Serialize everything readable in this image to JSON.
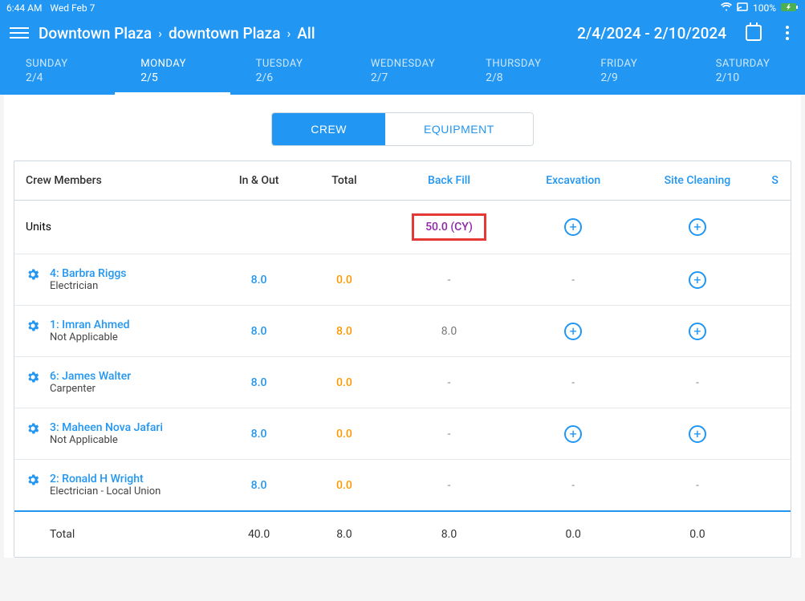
{
  "status": {
    "time": "6:44 AM",
    "date": "Wed Feb 7",
    "battery": "100%"
  },
  "breadcrumb": {
    "a": "Downtown Plaza",
    "b": "downtown Plaza",
    "c": "All"
  },
  "dateRange": "2/4/2024 - 2/10/2024",
  "days": [
    {
      "name": "SUNDAY",
      "date": "2/4",
      "active": false
    },
    {
      "name": "MONDAY",
      "date": "2/5",
      "active": true
    },
    {
      "name": "TUESDAY",
      "date": "2/6",
      "active": false
    },
    {
      "name": "WEDNESDAY",
      "date": "2/7",
      "active": false
    },
    {
      "name": "THURSDAY",
      "date": "2/8",
      "active": false
    },
    {
      "name": "FRIDAY",
      "date": "2/9",
      "active": false
    },
    {
      "name": "SATURDAY",
      "date": "2/10",
      "active": false
    }
  ],
  "toggle": {
    "crew": "CREW",
    "equipment": "EQUIPMENT"
  },
  "columns": {
    "members": "Crew Members",
    "inout": "In & Out",
    "total": "Total",
    "backfill": "Back Fill",
    "excavation": "Excavation",
    "site": "Site Cleaning",
    "s": "S"
  },
  "unitsLabel": "Units",
  "unitsBackfill": "50.0 (CY)",
  "crew": [
    {
      "name": "4: Barbra Riggs",
      "role": "Electrician",
      "inout": "8.0",
      "total": "0.0",
      "backfill": "-",
      "excavation": "-",
      "site": "plus"
    },
    {
      "name": "1: Imran Ahmed",
      "role": "Not Applicable",
      "inout": "8.0",
      "total": "8.0",
      "backfill": "8.0",
      "excavation": "plus",
      "site": "plus"
    },
    {
      "name": "6: James Walter",
      "role": "Carpenter",
      "inout": "8.0",
      "total": "0.0",
      "backfill": "-",
      "excavation": "-",
      "site": "-"
    },
    {
      "name": "3: Maheen  Nova Jafari",
      "role": "Not Applicable",
      "inout": "8.0",
      "total": "0.0",
      "backfill": "-",
      "excavation": "plus",
      "site": "plus"
    },
    {
      "name": "2: Ronald H Wright",
      "role": "Electrician - Local Union",
      "inout": "8.0",
      "total": "0.0",
      "backfill": "-",
      "excavation": "-",
      "site": "-"
    }
  ],
  "totals": {
    "label": "Total",
    "inout": "40.0",
    "total": "8.0",
    "backfill": "8.0",
    "excavation": "0.0",
    "site": "0.0"
  }
}
